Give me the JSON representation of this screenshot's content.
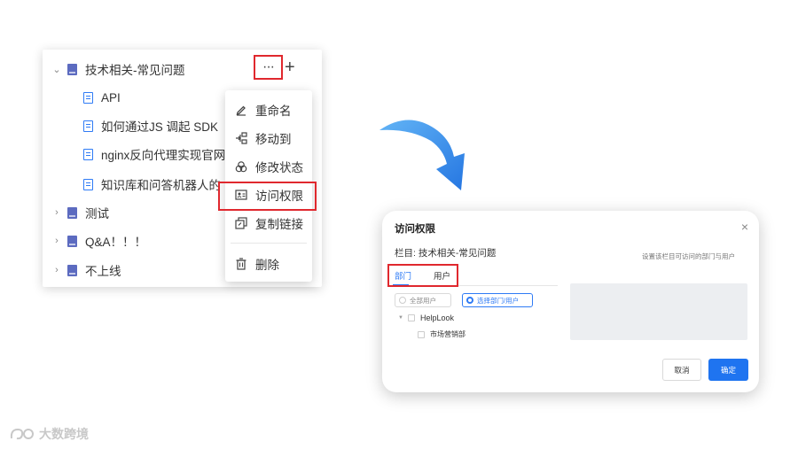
{
  "tree": {
    "root": {
      "label": "技术相关-常见问题",
      "expanded": true
    },
    "children": [
      {
        "label": "API"
      },
      {
        "label": "如何通过JS 调起 SDK"
      },
      {
        "label": "nginx反向代理实现官网"
      },
      {
        "label": "知识库和问答机器人的"
      }
    ],
    "siblings": [
      {
        "label": "测试"
      },
      {
        "label": "Q&A！！！"
      },
      {
        "label": "不上线"
      }
    ],
    "more_label": "···",
    "add_label": "+"
  },
  "context_menu": {
    "items": [
      {
        "label": "重命名",
        "icon": "pencil-icon"
      },
      {
        "label": "移动到",
        "icon": "move-icon"
      },
      {
        "label": "修改状态",
        "icon": "status-icon"
      },
      {
        "label": "访问权限",
        "icon": "permission-icon",
        "highlighted": true
      },
      {
        "label": "复制链接",
        "icon": "copy-link-icon"
      },
      {
        "label": "删除",
        "icon": "trash-icon"
      }
    ]
  },
  "dialog": {
    "title": "访问权限",
    "close_label": "×",
    "column_label": "栏目:  技术相关-常见问题",
    "hint": "设置该栏目可访问的部门与用户",
    "tabs": [
      {
        "label": "部门",
        "active": true
      },
      {
        "label": "用户",
        "active": false
      }
    ],
    "radio_all": "全部用户",
    "radio_selected": "选择部门/用户",
    "org_tree": [
      {
        "label": "HelpLook"
      },
      {
        "label": "市场营销部"
      }
    ],
    "cancel_label": "取消",
    "ok_label": "确定"
  },
  "watermark": {
    "text": "大数跨境"
  },
  "colors": {
    "accent": "#2f7bf5",
    "highlight_border": "#e0282e",
    "primary_button": "#1f74f0"
  }
}
